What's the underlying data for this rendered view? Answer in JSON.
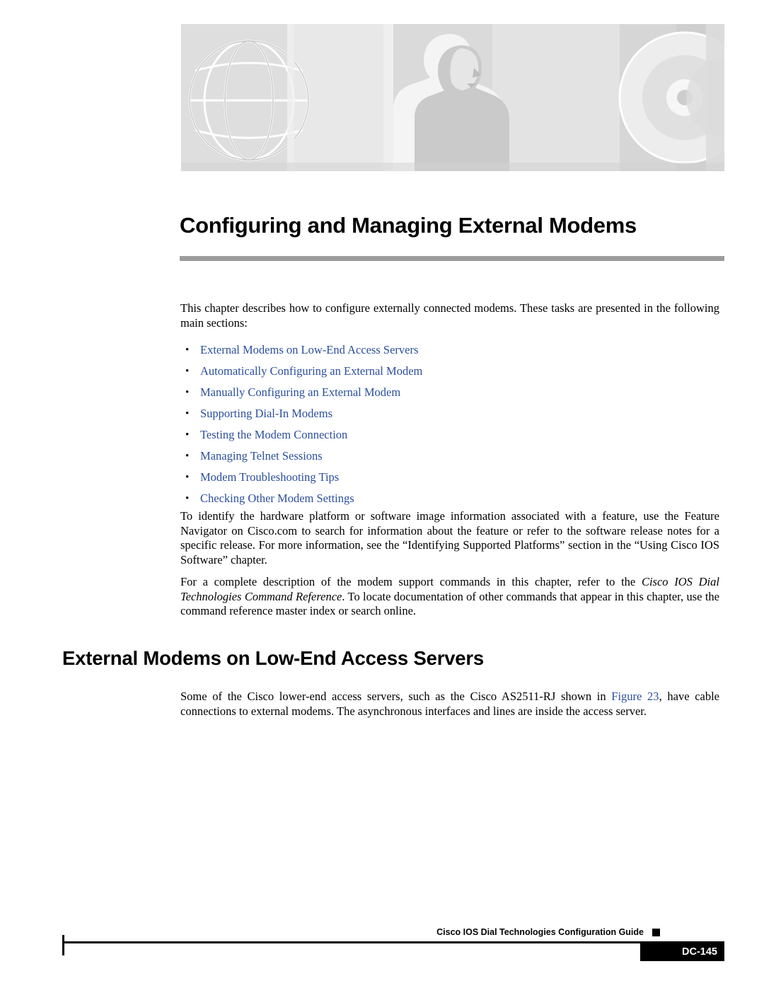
{
  "document": {
    "chapter_title": "Configuring and Managing External Modems",
    "intro_paragraph": "This chapter describes how to configure externally connected modems. These tasks are presented in the following main sections:",
    "toc_links": [
      "External Modems on Low-End Access Servers",
      "Automatically Configuring an External Modem",
      "Manually Configuring an External Modem",
      "Supporting Dial-In Modems",
      "Testing the Modem Connection",
      "Managing Telnet Sessions",
      "Modem Troubleshooting Tips",
      "Checking Other Modem Settings"
    ],
    "paragraph_feature_navigator": "To identify the hardware platform or software image information associated with a feature, use the Feature Navigator on Cisco.com to search for information about the feature or refer to the software release notes for a specific release. For more information, see the “Identifying Supported Platforms” section in the “Using Cisco IOS Software” chapter.",
    "paragraph_command_reference_a": "For a complete description of the modem support commands in this chapter, refer to the ",
    "paragraph_command_reference_italic1": "Cisco IOS Dial Technologies Command Reference",
    "paragraph_command_reference_b": ". To locate documentation of other commands that appear in this chapter, use the command reference master index or search online.",
    "section_heading": "External Modems on Low-End Access Servers",
    "paragraph_section_a": "Some of the Cisco lower-end access servers, such as the Cisco AS2511-RJ shown in ",
    "paragraph_section_link": "Figure 23",
    "paragraph_section_b": ", have cable connections to external modems. The asynchronous interfaces and lines are inside the access server."
  },
  "footer": {
    "guide_title": "Cisco IOS Dial Technologies Configuration Guide",
    "page_number": "DC-145"
  },
  "colors": {
    "link": "#2b4e9e",
    "rule_gray": "#9c9c9c",
    "banner_light": "#e9e9e9",
    "banner_mid": "#cfcfcf",
    "banner_dark": "#b4b4b4"
  }
}
